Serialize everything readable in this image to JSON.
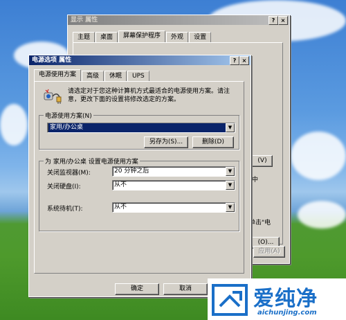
{
  "back_window": {
    "title": "显示 属性",
    "title_buttons": [
      "?",
      "×"
    ],
    "tabs": [
      "主题",
      "桌面",
      "屏幕保护程序",
      "外观",
      "设置"
    ],
    "active_tab": 2,
    "partial_button_1": "(V)",
    "partial_text_1": "中",
    "partial_text_2": "单击\"电",
    "partial_button_2": "(O)...",
    "apply_button": "应用(A)"
  },
  "front_window": {
    "title": "电源选项 属性",
    "title_buttons": [
      "?",
      "×"
    ],
    "tabs": [
      "电源使用方案",
      "高级",
      "休眠",
      "UPS"
    ],
    "active_tab": 0,
    "description": "请选定对于您这种计算机方式最适合的电源使用方案。请注意，更改下面的设置将修改选定的方案。",
    "scheme_group_label": "电源使用方案(N)",
    "scheme_value": "家用/办公桌",
    "save_as_button": "另存为(S)...",
    "delete_button": "删除(D)",
    "settings_group_label": "为 家用/办公桌 设置电源使用方案",
    "monitor_label": "关闭监视器(M):",
    "monitor_value": "20 分钟之后",
    "harddisk_label": "关闭硬盘(I):",
    "harddisk_value": "从不",
    "standby_label": "系统待机(T):",
    "standby_value": "从不",
    "ok_button": "确定",
    "cancel_button": "取消"
  },
  "watermark": {
    "brand_text": "爱纯净",
    "url": "aichunjing.com"
  },
  "colors": {
    "titlebar_active": "#0a246a",
    "face": "#d4d0c8",
    "brand_blue": "#1a6fc8"
  }
}
